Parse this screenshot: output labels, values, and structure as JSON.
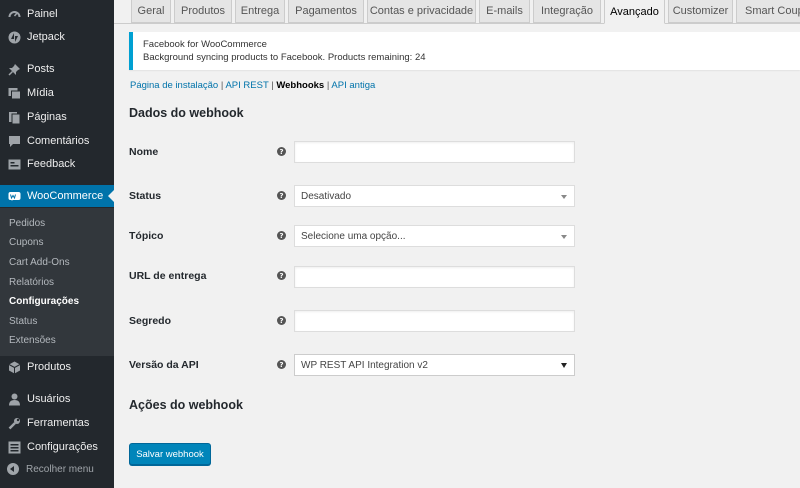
{
  "sidebar": {
    "items": [
      {
        "label": "Painel",
        "icon": "dashboard-icon"
      },
      {
        "label": "Jetpack",
        "icon": "jetpack-icon"
      },
      {
        "label": "Posts",
        "icon": "pin-icon"
      },
      {
        "label": "Mídia",
        "icon": "media-icon"
      },
      {
        "label": "Páginas",
        "icon": "pages-icon"
      },
      {
        "label": "Comentários",
        "icon": "comments-icon"
      },
      {
        "label": "Feedback",
        "icon": "feedback-icon"
      },
      {
        "label": "WooCommerce",
        "icon": "woocommerce-icon"
      },
      {
        "label": "Produtos",
        "icon": "products-icon"
      },
      {
        "label": "Usuários",
        "icon": "users-icon"
      },
      {
        "label": "Ferramentas",
        "icon": "tools-icon"
      },
      {
        "label": "Configurações",
        "icon": "settings-icon"
      }
    ],
    "woocommerce_submenu": [
      "Pedidos",
      "Cupons",
      "Cart Add-Ons",
      "Relatórios",
      "Configurações",
      "Status",
      "Extensões"
    ],
    "collapse_label": "Recolher menu"
  },
  "tabs": [
    "Geral",
    "Produtos",
    "Entrega",
    "Pagamentos",
    "Contas e privacidade",
    "E-mails",
    "Integração",
    "Avançado",
    "Customizer",
    "Smart Coup"
  ],
  "active_tab": "Avançado",
  "notice": {
    "title": "Facebook for WooCommerce",
    "message": "Background syncing products to Facebook. Products remaining: 24"
  },
  "section_links": {
    "setup": "Página de instalação",
    "rest_api": "API REST",
    "webhooks": "Webhooks",
    "legacy_api": "API antiga",
    "separator": " | "
  },
  "form": {
    "heading": "Dados do webhook",
    "fields": {
      "name": {
        "label": "Nome",
        "value": ""
      },
      "status": {
        "label": "Status",
        "value": "Desativado"
      },
      "topic": {
        "label": "Tópico",
        "value": "Selecione uma opção..."
      },
      "delivery_url": {
        "label": "URL de entrega",
        "value": ""
      },
      "secret": {
        "label": "Segredo",
        "value": ""
      },
      "api_version": {
        "label": "Versão da API",
        "value": "WP REST API Integration v2"
      }
    },
    "help_glyph": "?",
    "actions_heading": "Ações do webhook",
    "save_label": "Salvar webhook"
  },
  "colors": {
    "sidebar_bg": "#23282d",
    "submenu_bg": "#32373c",
    "accent": "#0073aa",
    "button": "#0085ba",
    "notice_border": "#00a0d2"
  }
}
